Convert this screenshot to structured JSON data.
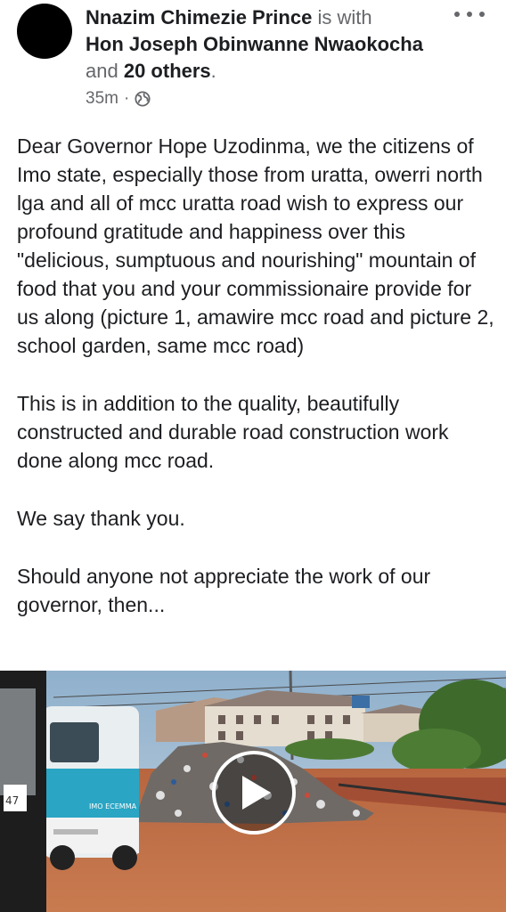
{
  "post": {
    "author": "Nnazim Chimezie Prince",
    "is_with": "is with",
    "tagged_name": "Hon Joseph Obinwanne Nwaokocha",
    "and_text": "and",
    "others": "20 others",
    "period": ".",
    "time": "35m",
    "separator": "·",
    "privacy_icon": "globe-icon",
    "more_icon": "more-options-icon"
  },
  "body": {
    "paragraphs": [
      "Dear Governor Hope Uzodinma, we the citizens of Imo state, especially those from uratta, owerri north lga and all of mcc uratta road wish to express our profound gratitude and happiness over this \"delicious, sumptuous and nourishing\" mountain of food that you and your commissionaire provide for us along (picture 1, amawire mcc road and picture 2, school garden, same mcc road)",
      "This is in addition to the quality, beautifully constructed and durable road construction work done along mcc road.",
      "We say thank you.",
      "Should anyone not appreciate the work of our governor, then..."
    ]
  },
  "media": {
    "bus_text": "IMO ECEMMA",
    "play_icon": "play-icon",
    "sign_text": "47"
  }
}
